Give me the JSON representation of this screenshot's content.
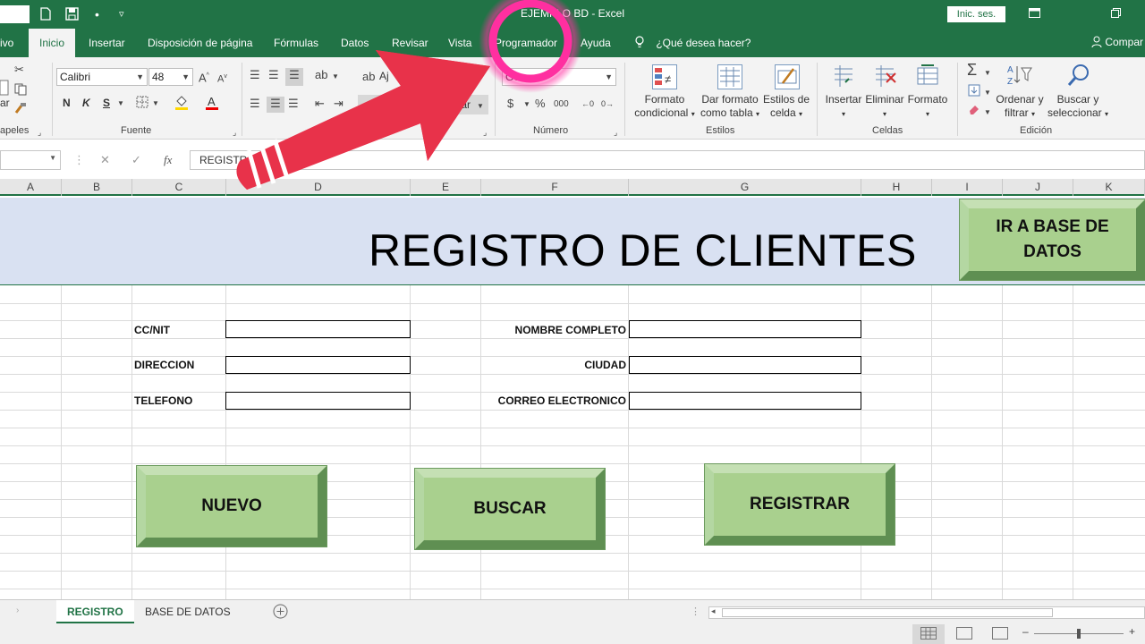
{
  "window": {
    "title": "EJEMPLO BD  -  Excel",
    "signin": "Inic. ses."
  },
  "ribbon_tabs": [
    "ivo",
    "Inicio",
    "Insertar",
    "Disposición de página",
    "Fórmulas",
    "Datos",
    "Revisar",
    "Vista",
    "Programador",
    "Ayuda"
  ],
  "tell_me": "¿Qué desea hacer?",
  "share": "Compar",
  "ribbon": {
    "clipboard_label": "apeles",
    "clipboard_frag": "ar",
    "font": {
      "name": "Calibri",
      "size": "48",
      "label": "Fuente",
      "bold": "N",
      "italic": "K",
      "underline": "S"
    },
    "alignment_frag1": "Aj",
    "alignment_frag2": "trar",
    "number": {
      "format": "General",
      "label": "Número"
    },
    "styles": {
      "label": "Estilos",
      "conditional": [
        "Formato",
        "condicional"
      ],
      "as_table": [
        "Dar formato",
        "como tabla"
      ],
      "cell_styles": [
        "Estilos de",
        "celda"
      ]
    },
    "cells": {
      "label": "Celdas",
      "insert": "Insertar",
      "delete": "Eliminar",
      "format": "Formato"
    },
    "editing": {
      "label": "Edición",
      "sort": [
        "Ordenar y",
        "filtrar"
      ],
      "find": [
        "Buscar y",
        "seleccionar"
      ]
    }
  },
  "formula_bar": {
    "fx": "fx",
    "content": "REGISTRO DE CLI"
  },
  "columns": [
    "A",
    "B",
    "C",
    "D",
    "E",
    "F",
    "G",
    "H",
    "I",
    "J",
    "K"
  ],
  "sheet": {
    "title": "REGISTRO DE CLIENTES",
    "fields": {
      "ccnit": "CC/NIT",
      "direccion": "DIRECCION",
      "telefono": "TELEFONO",
      "nombre": "NOMBRE COMPLETO",
      "ciudad": "CIUDAD",
      "correo": "CORREO ELECTRONICO"
    },
    "buttons": {
      "goto_db": "IR A BASE DE DATOS",
      "nuevo": "NUEVO",
      "buscar": "BUSCAR",
      "registrar": "REGISTRAR"
    }
  },
  "sheet_tabs": [
    "REGISTRO",
    "BASE DE DATOS"
  ],
  "colors": {
    "excel_green": "#217346",
    "banner_fill": "#d9e1f2",
    "button_fill": "#a9d08e",
    "arrow": "#e8324a",
    "highlight": "#ff2fa0"
  },
  "icons": [
    "new-file-icon",
    "save-icon",
    "undo-icon",
    "customize-qat-icon",
    "lightbulb-icon",
    "user-icon",
    "sum-icon",
    "sort-filter-icon",
    "find-icon",
    "fx-icon",
    "add-sheet-icon"
  ]
}
